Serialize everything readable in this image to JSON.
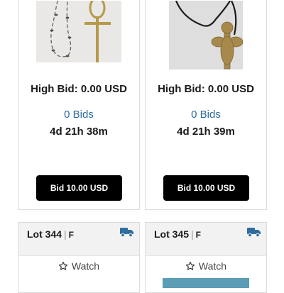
{
  "lots": [
    {
      "high_bid": "High Bid: 0.00 USD",
      "bids": "0 Bids",
      "time_left": "4d 21h 38m",
      "bid_button": "Bid 10.00 USD"
    },
    {
      "high_bid": "High Bid: 0.00 USD",
      "bids": "0 Bids",
      "time_left": "4d 21h 39m",
      "bid_button": "Bid 10.00 USD"
    },
    {
      "lot_label": "Lot 344",
      "separator": "|",
      "flag": "F",
      "watch": "Watch",
      "shipping_icon": "truck-icon"
    },
    {
      "lot_label": "Lot 345",
      "separator": "|",
      "flag": "F",
      "watch": "Watch",
      "shipping_icon": "truck-icon"
    }
  ],
  "colors": {
    "bids_link": "#2a6aa0",
    "button_bg": "#000000",
    "truck_icon": "#2f6c9f",
    "header_bg": "#f2f2f2"
  }
}
